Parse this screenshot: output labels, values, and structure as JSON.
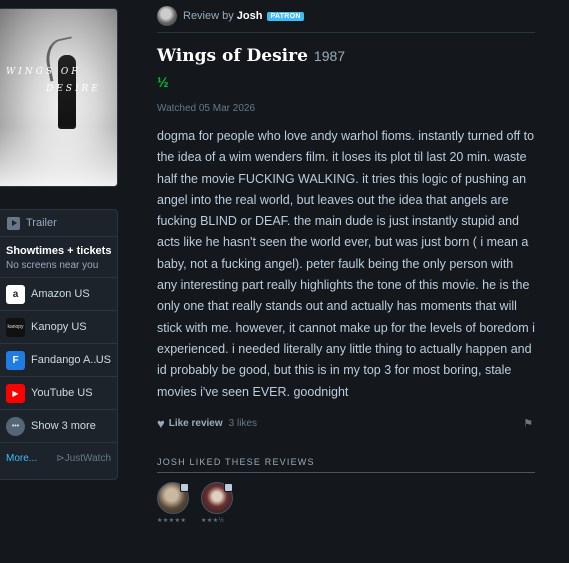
{
  "poster": {
    "title_line1": "WINGS OF",
    "title_line2": "DESIRE"
  },
  "sidebar": {
    "trailer_label": "Trailer",
    "showtimes_title": "Showtimes + tickets",
    "showtimes_sub": "No screens near you",
    "services": [
      {
        "label": "Amazon US",
        "country": "",
        "icon": "amazon-icon",
        "logo_text": "a",
        "logo_bg": "#ffffff",
        "logo_fg": "#222222"
      },
      {
        "label": "Kanopy US",
        "country": "",
        "icon": "kanopy-icon",
        "logo_text": "kanopy",
        "logo_bg": "#111111",
        "logo_fg": "#dddddd"
      },
      {
        "label": "Fandango A...",
        "country": "US",
        "icon": "fandango-icon",
        "logo_text": "F",
        "logo_bg": "#1f7de2",
        "logo_fg": "#ffffff"
      },
      {
        "label": "YouTube US",
        "country": "",
        "icon": "youtube-icon",
        "logo_text": "▶",
        "logo_bg": "#ff0000",
        "logo_fg": "#ffffff"
      },
      {
        "label": "Show 3 more",
        "country": "",
        "icon": "more-dots-icon",
        "logo_text": "•••",
        "logo_bg": "#556677",
        "logo_fg": "#ccddee"
      }
    ],
    "more_label": "More...",
    "justwatch_label": "⊳JustWatch"
  },
  "review": {
    "by_prefix": "Review by",
    "author": "Josh",
    "patron_badge": "PATRON",
    "film_title": "Wings of Desire",
    "film_year": "1987",
    "rating": "½",
    "watched": "Watched 05 Mar 2026",
    "body": "dogma for people who love andy warhol fioms. instantly turned off to the idea of a wim wenders film. it loses its plot til last 20 min. waste half the movie FUCKING WALKING. it tries this logic of pushing an angel into the real world, but leaves out the idea that angels are fucking BLIND or DEAF. the main dude is just instantly stupid and acts like he hasn't seen the world ever, but was just born ( i mean a baby, not a fucking angel). peter faulk being the only person with any interesting part really highlights the tone of this movie. he is the only one that really stands out and actually has moments that will stick with me. however, it cannot make up for the levels of boredom i experienced. i needed literally any little thing to actually happen and id probably be good, but this is in my top 3 for most boring, stale movies i've seen EVER. goodnight",
    "like_label": "Like review",
    "likes_count": "3 likes"
  },
  "liked_section": {
    "heading": "JOSH LIKED THESE REVIEWS",
    "items": [
      {
        "stars": "★★★★★"
      },
      {
        "stars": "★★★½"
      }
    ]
  },
  "colors": {
    "background": "#14181c",
    "accent_green": "#00c030",
    "accent_blue": "#40bcf4"
  }
}
